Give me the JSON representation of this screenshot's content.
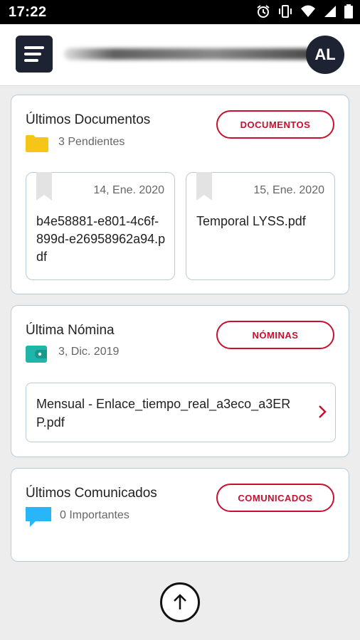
{
  "status_bar": {
    "time": "17:22"
  },
  "header": {
    "avatar_initials": "AL"
  },
  "documents_card": {
    "title": "Últimos Documentos",
    "pending": "3 Pendientes",
    "button_label": "DOCUMENTOS",
    "items": [
      {
        "date": "14, Ene. 2020",
        "name": "b4e58881-e801-4c6f-899d-e26958962a94.pdf"
      },
      {
        "date": "15, Ene. 2020",
        "name": "Temporal LYSS.pdf"
      }
    ]
  },
  "payroll_card": {
    "title": "Última Nómina",
    "date": "3, Dic. 2019",
    "button_label": "NÓMINAS",
    "item_name": "Mensual - Enlace_tiempo_real_a3eco_a3ERP.pdf"
  },
  "communications_card": {
    "title": "Últimos Comunicados",
    "important": "0 Importantes",
    "button_label": "COMUNICADOS"
  },
  "colors": {
    "accent": "#c8102e",
    "dark": "#1d2333",
    "folder": "#f5c518",
    "wallet": "#1fb5a8",
    "chat": "#29b6f6"
  },
  "icons": [
    "alarm-icon",
    "vibrate-icon",
    "wifi-icon",
    "signal-icon",
    "battery-icon",
    "menu-icon",
    "folder-icon",
    "bookmark-icon",
    "wallet-icon",
    "chevron-right-icon",
    "chat-icon",
    "arrow-up-icon"
  ]
}
